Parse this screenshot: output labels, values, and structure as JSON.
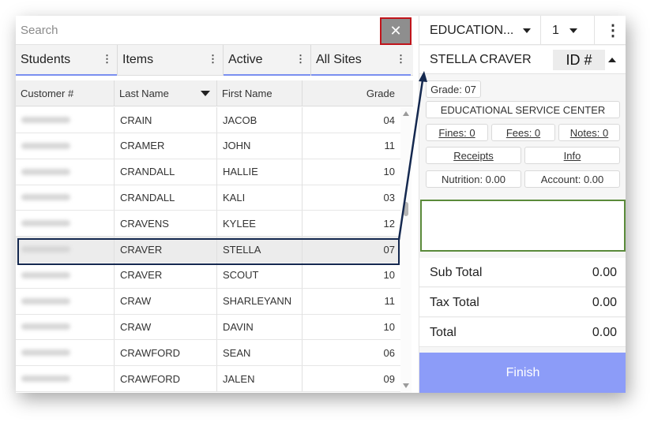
{
  "search": {
    "placeholder": "Search",
    "clear_icon": "close-icon"
  },
  "filters": [
    {
      "label": "Students"
    },
    {
      "label": "Items"
    },
    {
      "label": "Active"
    },
    {
      "label": "All Sites"
    }
  ],
  "table": {
    "columns": [
      "Customer #",
      "Last Name",
      "First Name",
      "Grade"
    ],
    "rows": [
      {
        "last": "CRAIN",
        "first": "JACOB",
        "grade": "04"
      },
      {
        "last": "CRAMER",
        "first": "JOHN",
        "grade": "11"
      },
      {
        "last": "CRANDALL",
        "first": "HALLIE",
        "grade": "10"
      },
      {
        "last": "CRANDALL",
        "first": "KALI",
        "grade": "03"
      },
      {
        "last": "CRAVENS",
        "first": "KYLEE",
        "grade": "12"
      },
      {
        "last": "CRAVER",
        "first": "STELLA",
        "grade": "07"
      },
      {
        "last": "CRAVER",
        "first": "SCOUT",
        "grade": "10"
      },
      {
        "last": "CRAW",
        "first": "SHARLEYANN",
        "grade": "11"
      },
      {
        "last": "CRAW",
        "first": "DAVIN",
        "grade": "10"
      },
      {
        "last": "CRAWFORD",
        "first": "SEAN",
        "grade": "06"
      },
      {
        "last": "CRAWFORD",
        "first": "JALEN",
        "grade": "09"
      }
    ],
    "selected_row": 5
  },
  "right": {
    "site_dropdown": "EDUCATION...",
    "register_dropdown": "1",
    "student_name": "STELLA CRAVER",
    "id_label": "ID #",
    "grade": "Grade: 07",
    "school": "EDUCATIONAL SERVICE CENTER",
    "fines": "Fines: 0",
    "fees": "Fees: 0",
    "notes": "Notes: 0",
    "receipts": "Receipts",
    "info": "Info",
    "nutrition": "Nutrition: 0.00",
    "account": "Account: 0.00"
  },
  "totals": {
    "subtotal_label": "Sub Total",
    "subtotal": "0.00",
    "tax_label": "Tax Total",
    "tax": "0.00",
    "total_label": "Total",
    "total": "0.00"
  },
  "finish_label": "Finish",
  "colors": {
    "accent": "#8c9cf8",
    "clear_button_outline": "#c0141b",
    "selection_outline": "#14284f",
    "entry_outline": "#5a8a3a"
  }
}
